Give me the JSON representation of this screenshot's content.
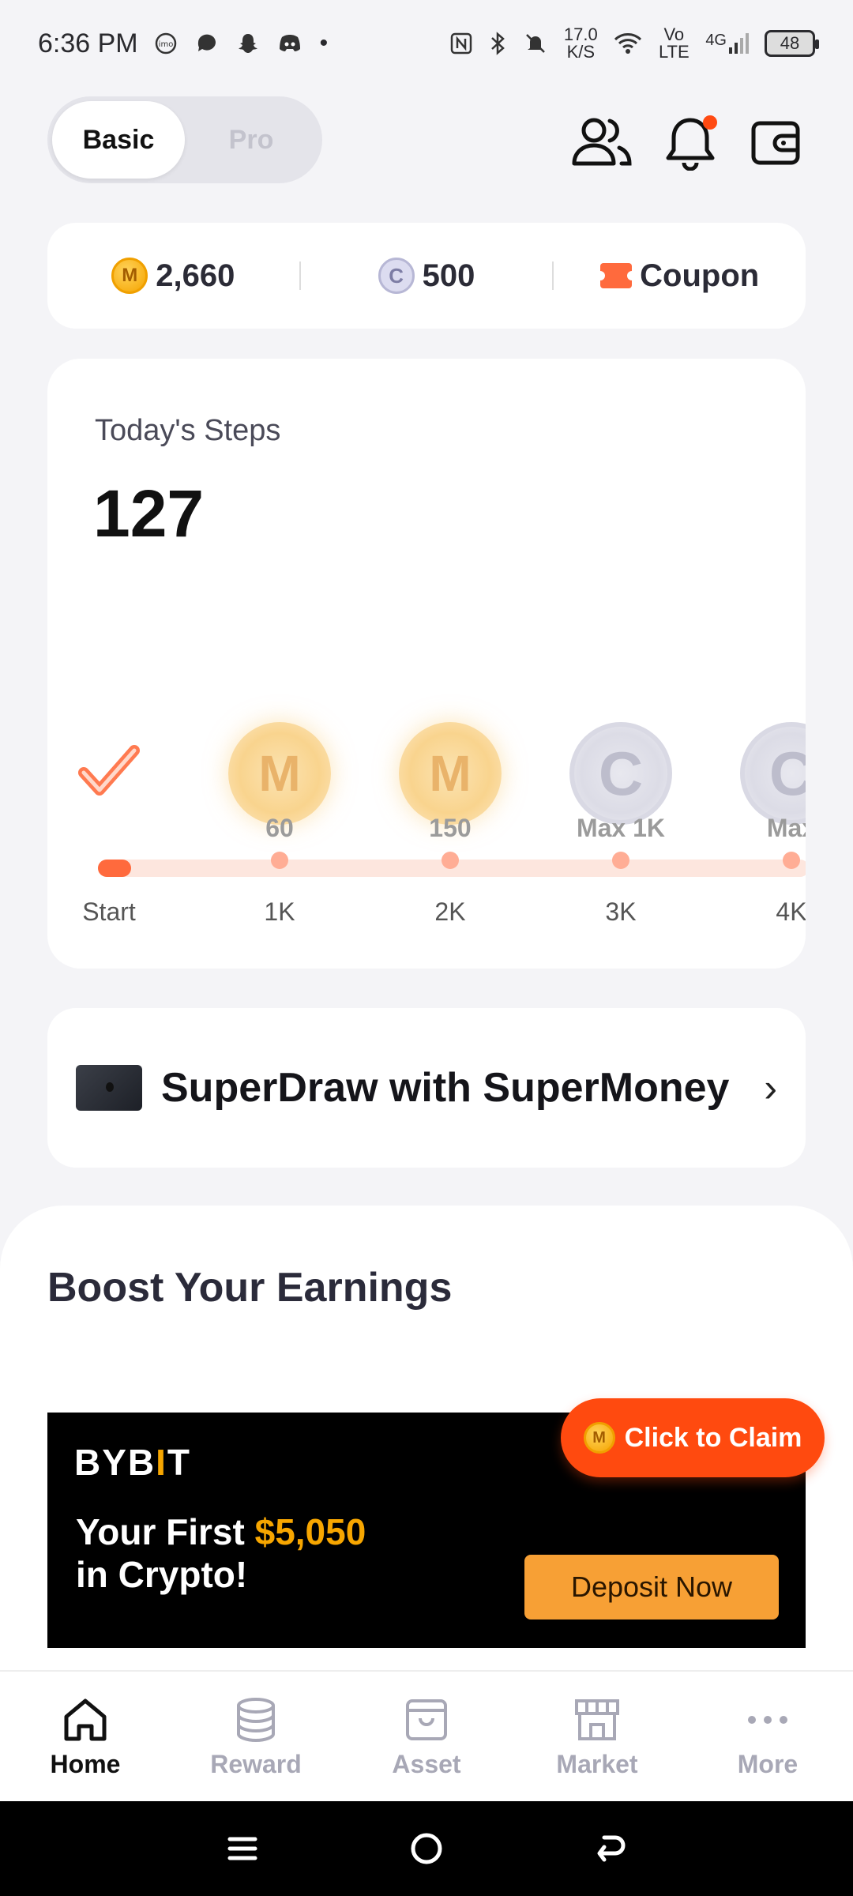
{
  "status_bar": {
    "time": "6:36 PM",
    "network_speed": "17.0 K/S",
    "network_type": "4G",
    "volte": "Vo LTE",
    "battery": "48"
  },
  "header": {
    "mode_toggle": {
      "basic": "Basic",
      "pro": "Pro",
      "selected": "Basic"
    },
    "icons": [
      "friends-icon",
      "bell-icon",
      "wallet-icon"
    ]
  },
  "balances": {
    "m_coin": "2,660",
    "c_coin": "500",
    "coupon_label": "Coupon"
  },
  "steps": {
    "title": "Today's Steps",
    "value": "127",
    "milestones": [
      {
        "label": "Start",
        "reward": ""
      },
      {
        "label": "1K",
        "reward": "60",
        "coin": "M"
      },
      {
        "label": "2K",
        "reward": "150",
        "coin": "M"
      },
      {
        "label": "3K",
        "reward": "Max 1K",
        "coin": "C"
      },
      {
        "label": "4K",
        "reward": "Max",
        "coin": "C"
      }
    ]
  },
  "superdraw": {
    "label": "SuperDraw with SuperMoney"
  },
  "boost": {
    "title": "Boost Your Earnings",
    "banner": {
      "brand": "BYBIT",
      "line1_prefix": "Your First ",
      "line1_amount": "$5,050",
      "line2": "in Crypto!",
      "cta": "Deposit Now"
    },
    "claim_button": "Click to Claim"
  },
  "bottom_nav": [
    {
      "label": "Home",
      "icon": "home-icon",
      "active": true
    },
    {
      "label": "Reward",
      "icon": "coins-stack-icon",
      "active": false
    },
    {
      "label": "Asset",
      "icon": "bag-icon",
      "active": false
    },
    {
      "label": "Market",
      "icon": "store-icon",
      "active": false
    },
    {
      "label": "More",
      "icon": "more-dots-icon",
      "active": false
    }
  ],
  "colors": {
    "accent": "#ff4a0f",
    "progress": "#ff6a3d",
    "track": "#fde6de",
    "coin_gold": "#f5a400",
    "bybit_orange": "#f7a600"
  }
}
